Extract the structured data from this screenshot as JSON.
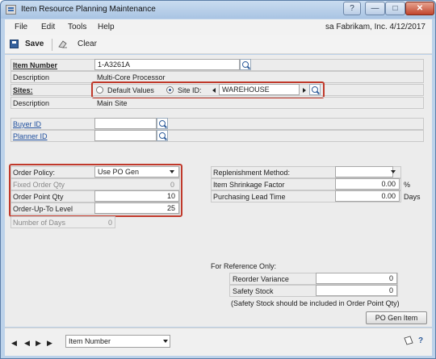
{
  "window": {
    "title": "Item Resource Planning Maintenance"
  },
  "menu": {
    "file": "File",
    "edit": "Edit",
    "tools": "Tools",
    "help": "Help"
  },
  "user_info": "sa  Fabrikam, Inc.  4/12/2017",
  "toolbar": {
    "save_label": "Save",
    "clear_label": "Clear"
  },
  "item": {
    "number_label": "Item Number",
    "number_value": "1-A3261A",
    "description_label": "Description",
    "description_value": "Multi-Core Processor"
  },
  "sites": {
    "label": "Sites:",
    "default_values_label": "Default Values",
    "site_id_label": "Site ID:",
    "site_id_value": "WAREHOUSE",
    "selected": "site_id",
    "description_label": "Description",
    "description_value": "Main Site"
  },
  "buyer": {
    "buyer_id_label": "Buyer ID",
    "buyer_id_value": "",
    "planner_id_label": "Planner ID",
    "planner_id_value": ""
  },
  "order": {
    "policy_label": "Order Policy:",
    "policy_value": "Use PO Gen",
    "fixed_qty_label": "Fixed Order Qty",
    "fixed_qty_value": "0",
    "point_qty_label": "Order Point Qty",
    "point_qty_value": "10",
    "up_to_label": "Order-Up-To Level",
    "up_to_value": "25",
    "days_label": "Number of Days",
    "days_value": "0"
  },
  "replenishment": {
    "method_label": "Replenishment Method:",
    "method_value": "",
    "shrinkage_label": "Item Shrinkage Factor",
    "shrinkage_value": "0.00",
    "shrinkage_unit": "%",
    "lead_time_label": "Purchasing Lead Time",
    "lead_time_value": "0.00",
    "lead_time_unit": "Days"
  },
  "reference": {
    "heading": "For Reference Only:",
    "reorder_label": "Reorder Variance",
    "reorder_value": "0",
    "safety_label": "Safety Stock",
    "safety_value": "0",
    "note": "(Safety Stock should be included in Order Point Qty)"
  },
  "po_gen_button": "PO Gen Item",
  "bottom": {
    "sort_value": "Item Number"
  },
  "colors": {
    "highlight": "#c0392b",
    "link": "#1f4f9e",
    "frame": "#bcd2ea"
  }
}
